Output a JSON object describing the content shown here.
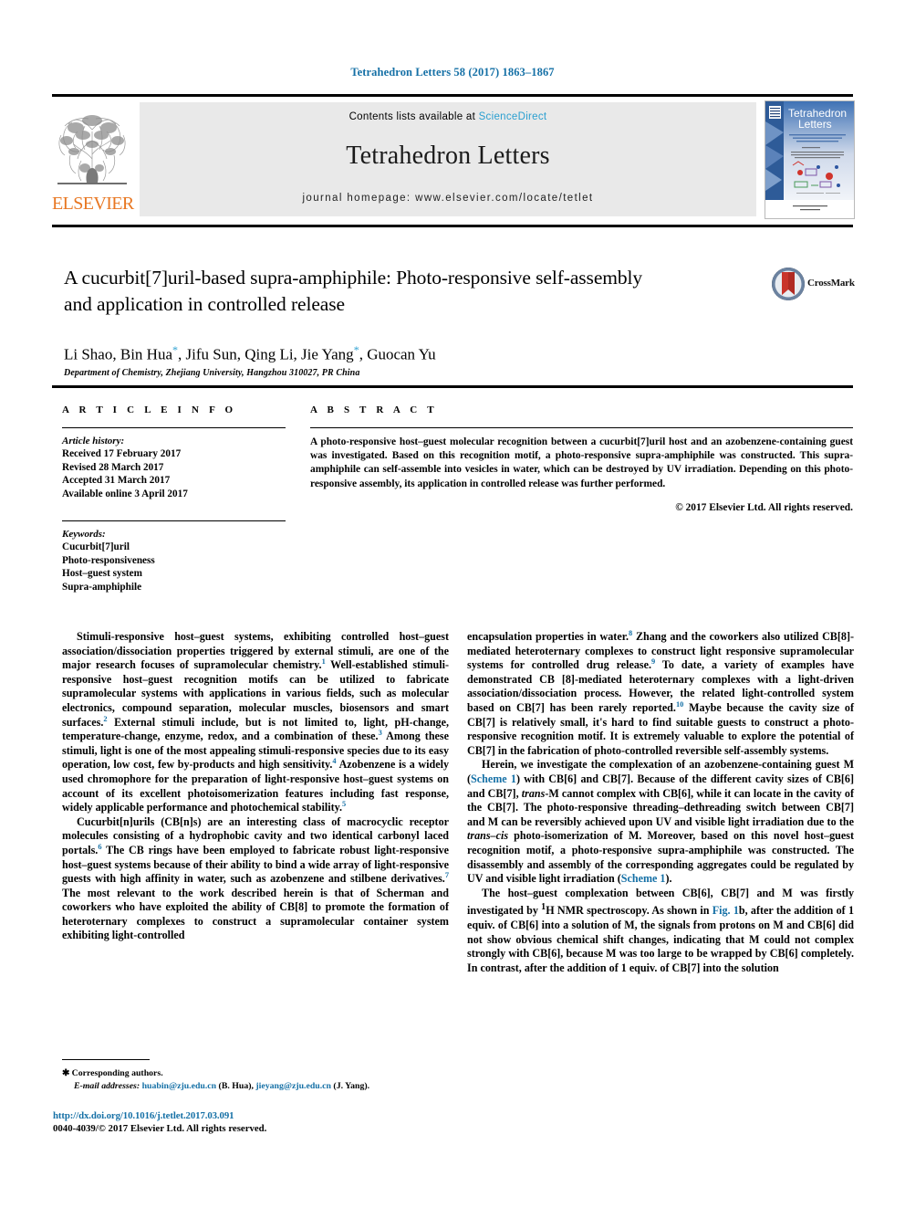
{
  "running_head": "Tetrahedron Letters 58 (2017) 1863–1867",
  "masthead": {
    "contents_prefix": "Contents lists available at ",
    "sciencedirect": "ScienceDirect",
    "journal_name": "Tetrahedron Letters",
    "homepage": "journal homepage: www.elsevier.com/locate/tetlet",
    "publisher": "ELSEVIER",
    "cover_title_line1": "Tetrahedron",
    "cover_title_line2": "Letters"
  },
  "article": {
    "title": "A cucurbit[7]uril-based supra-amphiphile: Photo-responsive self-assembly and application in controlled release",
    "authors": "Li Shao, Bin Hua",
    "authors_part2": ", Jifu Sun, Qing Li, Jie Yang",
    "authors_part3": ", Guocan Yu",
    "corresponding_mark": "*",
    "affiliation": "Department of Chemistry, Zhejiang University, Hangzhou 310027, PR China",
    "crossmark_label": "CrossMark"
  },
  "article_info": {
    "heading": "A R T I C L E   I N F O",
    "history_label": "Article history:",
    "history": [
      "Received 17 February 2017",
      "Revised 28 March 2017",
      "Accepted 31 March 2017",
      "Available online 3 April 2017"
    ],
    "keywords_label": "Keywords:",
    "keywords": [
      "Cucurbit[7]uril",
      "Photo-responsiveness",
      "Host–guest system",
      "Supra-amphiphile"
    ]
  },
  "abstract": {
    "heading": "A B S T R A C T",
    "text": "A photo-responsive host–guest molecular recognition between a cucurbit[7]uril host and an azobenzene-containing guest was investigated. Based on this recognition motif, a photo-responsive supra-amphiphile was constructed. This supra-amphiphile can self-assemble into vesicles in water, which can be destroyed by UV irradiation. Depending on this photo-responsive assembly, its application in controlled release was further performed.",
    "copyright": "© 2017 Elsevier Ltd. All rights reserved."
  },
  "body": {
    "left": {
      "p1_a": "Stimuli-responsive host–guest systems, exhibiting controlled host–guest association/dissociation properties triggered by external stimuli, are one of the major research focuses of supramolecular chemistry.",
      "p1_r1": "1",
      "p1_b": " Well-established stimuli-responsive host–guest recognition motifs can be utilized to fabricate supramolecular systems with applications in various fields, such as molecular electronics, compound separation, molecular muscles, biosensors and smart surfaces.",
      "p1_r2": "2",
      "p1_c": " External stimuli include, but is not limited to, light, pH-change, temperature-change, enzyme, redox, and a combination of these.",
      "p1_r3": "3",
      "p1_d": " Among these stimuli, light is one of the most appealing stimuli-responsive species due to its easy operation, low cost, few by-products and high sensitivity.",
      "p1_r4": "4",
      "p1_e": " Azobenzene is a widely used chromophore for the preparation of light-responsive host–guest systems on account of its excellent photoisomerization features including fast response, widely applicable performance and photochemical stability.",
      "p1_r5": "5",
      "p2_a": "Cucurbit[n]urils (CB[n]s) are an interesting class of macrocyclic receptor molecules consisting of a hydrophobic cavity and two identical carbonyl laced portals.",
      "p2_r6": "6",
      "p2_b": " The CB rings have been employed to fabricate robust light-responsive host–guest systems because of their ability to bind a wide array of light-responsive guests with high affinity in water, such as azobenzene and stilbene derivatives.",
      "p2_r7": "7",
      "p2_c": " The most relevant to the work described herein is that of Scherman and coworkers who have exploited the ability of CB[8] to promote the formation of heteroternary complexes to construct a supramolecular container system exhibiting light-controlled"
    },
    "right": {
      "p1_a": "encapsulation properties in water.",
      "p1_r8": "8",
      "p1_b": " Zhang and the coworkers also utilized CB[8]-mediated heteroternary complexes to construct light responsive supramolecular systems for controlled drug release.",
      "p1_r9": "9",
      "p1_c": " To date, a variety of examples have demonstrated CB [8]-mediated heteroternary complexes with a light-driven association/dissociation process. However, the related light-controlled system based on CB[7] has been rarely reported.",
      "p1_r10": "10",
      "p1_d": " Maybe because the cavity size of CB[7] is relatively small, it's hard to find suitable guests to construct a photo-responsive recognition motif. It is extremely valuable to explore the potential of CB[7] in the fabrication of photo-controlled reversible self-assembly systems.",
      "p2_a": "Herein, we investigate the complexation of an azobenzene-containing guest M (",
      "p2_link1": "Scheme 1",
      "p2_b": ") with CB[6] and CB[7]. Because of the different cavity sizes of CB[6] and CB[7], ",
      "p2_i1": "trans",
      "p2_c": "-M cannot complex with CB[6], while it can locate in the cavity of the CB[7]. The photo-responsive threading–dethreading switch between CB[7] and M can be reversibly achieved upon UV and visible light irradiation due to the ",
      "p2_i2": "trans–cis",
      "p2_d": " photo-isomerization of M. Moreover, based on this novel host–guest recognition motif, a photo-responsive supra-amphiphile was constructed. The disassembly and assembly of the corresponding aggregates could be regulated by UV and visible light irradiation (",
      "p2_link2": "Scheme 1",
      "p2_e": ").",
      "p3_a": "The host–guest complexation between CB[6], CB[7] and M was firstly investigated by ",
      "p3_sup": "1",
      "p3_b": "H NMR spectroscopy. As shown in ",
      "p3_link1": "Fig. 1",
      "p3_c": "b, after the addition of 1 equiv. of CB[6] into a solution of M, the signals from protons on M and CB[6] did not show obvious chemical shift changes, indicating that M could not complex strongly with CB[6], because M was too large to be wrapped by CB[6] completely. In contrast, after the addition of 1 equiv. of CB[7] into the solution"
    }
  },
  "footnote": {
    "corresponding": "Corresponding authors.",
    "email_label": "E-mail addresses:",
    "email1": "huabin@zju.edu.cn",
    "email1_who": " (B. Hua), ",
    "email2": "jieyang@zju.edu.cn",
    "email2_who": " (J. Yang)."
  },
  "footer": {
    "doi": "http://dx.doi.org/10.1016/j.tetlet.2017.03.091",
    "issn": "0040-4039/© 2017 Elsevier Ltd. All rights reserved."
  },
  "colors": {
    "link_blue": "#1570a6",
    "sciencedirect_blue": "#2a9fd0",
    "elsevier_orange": "#e87722",
    "crossmark_red": "#b02a23",
    "band_grey": "#e9e9e9"
  }
}
